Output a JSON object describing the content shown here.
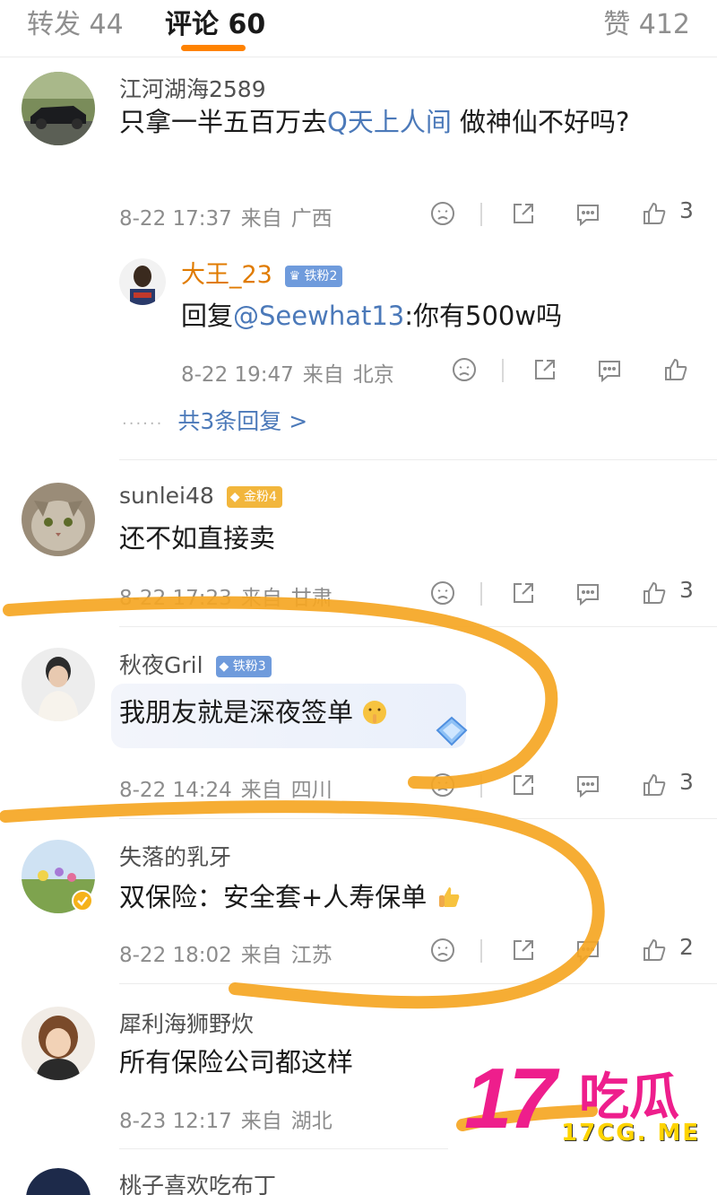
{
  "tabs": {
    "reposts": "转发 44",
    "comments": "评论 60",
    "likes": "赞 412"
  },
  "comments": [
    {
      "username": "江河湖海2589",
      "text_prefix": "只拿一半五百万去",
      "topic_link": "Q天上人间",
      "text_suffix": " 做神仙不好吗?",
      "date": "8-22 17:37",
      "from": "来自",
      "location": "广西",
      "likes": "3",
      "reply": {
        "username": "大王_23",
        "badge": "铁粉2",
        "reply_label": "回复",
        "mention": "@Seewhat13",
        "text": ":你有500w吗",
        "date": "8-22 19:47",
        "from": "来自",
        "location": "北京"
      },
      "more_replies": "共3条回复 >"
    },
    {
      "username": "sunlei48",
      "badge": "金粉4",
      "text": "还不如直接卖",
      "date": "8-22 17:23",
      "from": "来自",
      "location": "甘肃",
      "likes": "3"
    },
    {
      "username": "秋夜Gril",
      "badge": "铁粉3",
      "text": "我朋友就是深夜签单",
      "date": "8-22 14:24",
      "from": "来自",
      "location": "四川",
      "likes": "3"
    },
    {
      "username": "失落的乳牙",
      "text": "双保险：安全套+人寿保单",
      "date": "8-22 18:02",
      "from": "来自",
      "location": "江苏",
      "likes": "2"
    },
    {
      "username": "犀利海狮野炊",
      "text": "所有保险公司都这样",
      "date": "8-23 12:17",
      "from": "来自",
      "location": "湖北"
    },
    {
      "username": "桃子喜欢吃布丁"
    }
  ],
  "watermark": {
    "number": "17",
    "cjk": "吃瓜",
    "domain": "17CG. ME"
  },
  "colors": {
    "accent": "#ff8200",
    "link": "#4b79b9",
    "scribble": "#f5a623",
    "watermark": "#ee1e8c"
  }
}
